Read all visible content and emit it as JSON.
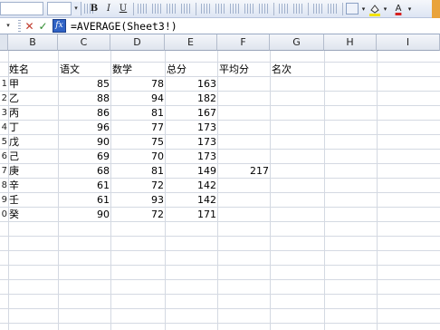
{
  "toolbar": {
    "font_size_arrow": "▾",
    "bold_label": "B",
    "italic_label": "I",
    "underline_label": "U",
    "font_color_label": "A",
    "font_color": "#d62020",
    "fill_color": "#f2e200"
  },
  "formula_bar": {
    "namebox_arrow": "▾",
    "cancel_symbol": "✕",
    "enter_symbol": "✓",
    "fx_label": "fx",
    "formula": "=AVERAGE(Sheet3!)"
  },
  "columns": [
    "B",
    "C",
    "D",
    "E",
    "F",
    "G",
    "H",
    "I"
  ],
  "header_row": {
    "row_number": "",
    "name": "姓名",
    "chinese": "语文",
    "math": "数学",
    "total": "总分",
    "average": "平均分",
    "rank": "名次"
  },
  "rows": [
    {
      "row_number": "1",
      "name": "甲",
      "chinese": "85",
      "math": "78",
      "total": "163",
      "average": ""
    },
    {
      "row_number": "2",
      "name": "乙",
      "chinese": "88",
      "math": "94",
      "total": "182",
      "average": ""
    },
    {
      "row_number": "3",
      "name": "丙",
      "chinese": "86",
      "math": "81",
      "total": "167",
      "average": ""
    },
    {
      "row_number": "4",
      "name": "丁",
      "chinese": "96",
      "math": "77",
      "total": "173",
      "average": ""
    },
    {
      "row_number": "5",
      "name": "戊",
      "chinese": "90",
      "math": "75",
      "total": "173",
      "average": ""
    },
    {
      "row_number": "6",
      "name": "己",
      "chinese": "69",
      "math": "70",
      "total": "173",
      "average": ""
    },
    {
      "row_number": "7",
      "name": "庚",
      "chinese": "68",
      "math": "81",
      "total": "149",
      "average": "217"
    },
    {
      "row_number": "8",
      "name": "辛",
      "chinese": "61",
      "math": "72",
      "total": "142",
      "average": ""
    },
    {
      "row_number": "9",
      "name": "壬",
      "chinese": "61",
      "math": "93",
      "total": "142",
      "average": ""
    },
    {
      "row_number": "0",
      "name": "癸",
      "chinese": "90",
      "math": "72",
      "total": "171",
      "average": ""
    }
  ]
}
